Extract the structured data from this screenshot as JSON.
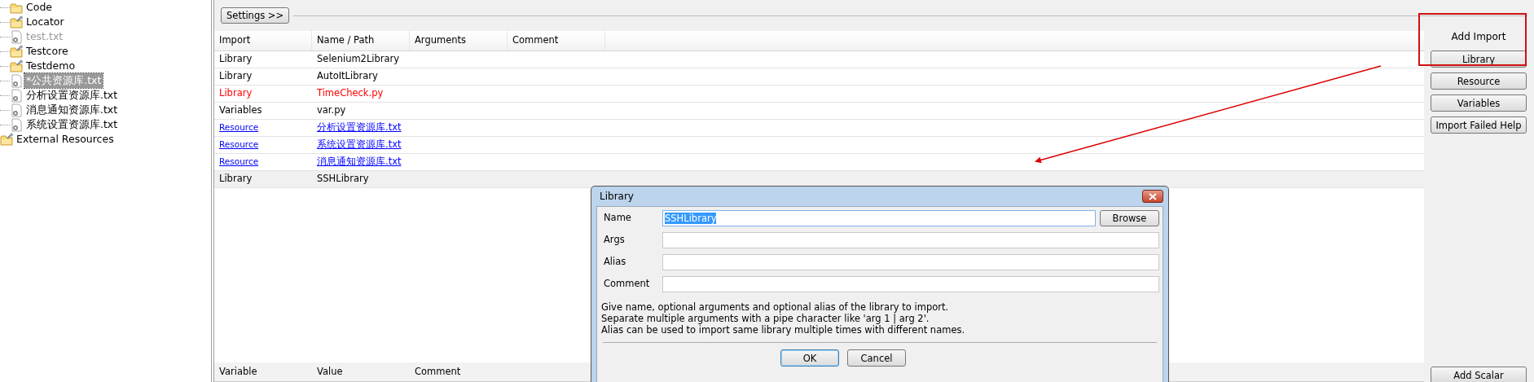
{
  "tree": [
    {
      "children": [
        {
          "label": "Code",
          "kind": "folder",
          "disabled": false,
          "selected": false
        },
        {
          "label": "Locator",
          "kind": "resource-folder",
          "disabled": false,
          "selected": false
        },
        {
          "label": "test.txt",
          "kind": "file",
          "disabled": true,
          "selected": false
        },
        {
          "label": "Testcore",
          "kind": "resource-folder",
          "disabled": false,
          "selected": false
        },
        {
          "label": "Testdemo",
          "kind": "resource-folder",
          "disabled": false,
          "selected": false
        },
        {
          "label": "*公共资源库.txt",
          "kind": "file",
          "disabled": false,
          "selected": true
        },
        {
          "label": "分析设置资源库.txt",
          "kind": "file",
          "disabled": false,
          "selected": false
        },
        {
          "label": "消息通知资源库.txt",
          "kind": "file",
          "disabled": false,
          "selected": false
        },
        {
          "label": "系统设置资源库.txt",
          "kind": "file",
          "disabled": false,
          "selected": false
        }
      ]
    },
    {
      "label": "External Resources",
      "kind": "resource-folder",
      "disabled": false,
      "selected": false
    }
  ],
  "settings_button": "Settings >>",
  "imports_table": {
    "columns": [
      "Import",
      "Name / Path",
      "Arguments",
      "Comment"
    ],
    "rows": [
      {
        "kind": "library",
        "import": "Library",
        "name": "Selenium2Library",
        "error": false,
        "selected": false
      },
      {
        "kind": "library",
        "import": "Library",
        "name": "AutoItLibrary",
        "error": false,
        "selected": false
      },
      {
        "kind": "library",
        "import": "Library",
        "name": "TimeCheck.py",
        "error": true,
        "selected": false
      },
      {
        "kind": "variables",
        "import": "Variables",
        "name": "var.py",
        "error": false,
        "selected": false
      },
      {
        "kind": "resource",
        "import": "Resource",
        "name": "分析设置资源库.txt",
        "error": false,
        "selected": false
      },
      {
        "kind": "resource",
        "import": "Resource",
        "name": "系统设置资源库.txt",
        "error": false,
        "selected": false
      },
      {
        "kind": "resource",
        "import": "Resource",
        "name": "消息通知资源库.txt",
        "error": false,
        "selected": false
      },
      {
        "kind": "library",
        "import": "Library",
        "name": "SSHLibrary",
        "error": false,
        "selected": true
      }
    ]
  },
  "variables_table": {
    "columns": [
      "Variable",
      "Value",
      "Comment"
    ]
  },
  "add_import": {
    "title": "Add Import",
    "buttons": [
      "Library",
      "Resource",
      "Variables",
      "Import Failed Help"
    ]
  },
  "add_scalar_button": "Add Scalar",
  "dialog": {
    "title": "Library",
    "fields": [
      {
        "label": "Name",
        "value": "SSHLibrary",
        "text_selected": true,
        "focused": true
      },
      {
        "label": "Args",
        "focused": false
      },
      {
        "label": "Alias",
        "focused": false
      },
      {
        "label": "Comment",
        "focused": false
      }
    ],
    "browse_button": "Browse",
    "help": [
      "Give name, optional arguments and optional alias of the library to import.",
      "Separate multiple arguments with a pipe character like 'arg 1 | arg 2'.",
      "Alias can be used to import same library multiple times with different names."
    ],
    "buttons": [
      {
        "label": "OK",
        "default": true
      },
      {
        "label": "Cancel",
        "default": false
      }
    ]
  }
}
